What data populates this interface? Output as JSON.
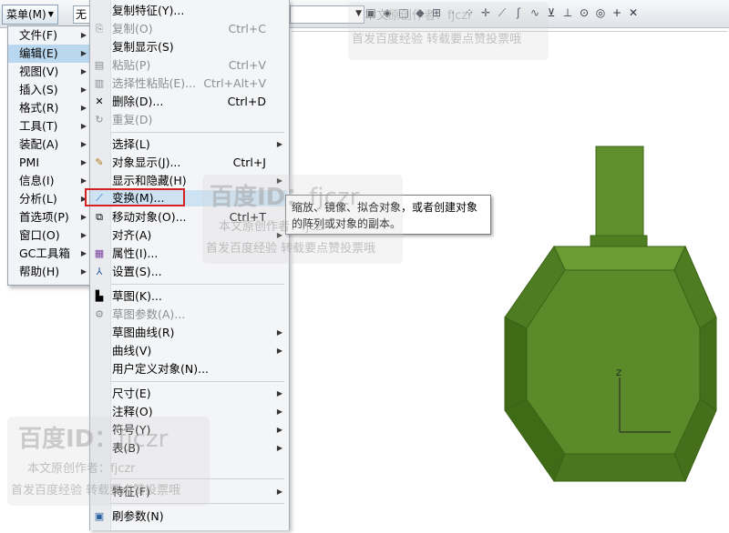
{
  "toolbar": {
    "menu_button": "菜单(M)",
    "filter_value": "无",
    "icons": [
      "view-icon",
      "snap-icon",
      "point-icon",
      "line-icon",
      "curve-icon",
      "arc-icon",
      "circle-icon",
      "plus-icon"
    ]
  },
  "main_menu": {
    "items": [
      {
        "label": "文件(F)",
        "has_sub": true
      },
      {
        "label": "编辑(E)",
        "has_sub": true,
        "active": true
      },
      {
        "label": "视图(V)",
        "has_sub": true
      },
      {
        "label": "插入(S)",
        "has_sub": true
      },
      {
        "label": "格式(R)",
        "has_sub": true
      },
      {
        "label": "工具(T)",
        "has_sub": true
      },
      {
        "label": "装配(A)",
        "has_sub": true
      },
      {
        "label": "PMI",
        "has_sub": true
      },
      {
        "label": "信息(I)",
        "has_sub": true
      },
      {
        "label": "分析(L)",
        "has_sub": true
      },
      {
        "label": "首选项(P)",
        "has_sub": true
      },
      {
        "label": "窗口(O)",
        "has_sub": true
      },
      {
        "label": "GC工具箱",
        "has_sub": true
      },
      {
        "label": "帮助(H)",
        "has_sub": true
      }
    ]
  },
  "edit_menu": {
    "items": [
      {
        "label": "复制特征(Y)...",
        "icon": "",
        "shortcut": ""
      },
      {
        "label": "复制(O)",
        "icon": "copy-icon",
        "shortcut": "Ctrl+C",
        "disabled": true
      },
      {
        "label": "复制显示(S)",
        "icon": "",
        "shortcut": ""
      },
      {
        "label": "粘贴(P)",
        "icon": "paste-icon",
        "shortcut": "Ctrl+V",
        "disabled": true
      },
      {
        "label": "选择性粘贴(E)...",
        "icon": "paste-special-icon",
        "shortcut": "Ctrl+Alt+V",
        "disabled": true
      },
      {
        "label": "删除(D)...",
        "icon": "delete-icon",
        "shortcut": "Ctrl+D"
      },
      {
        "label": "重复(D)",
        "icon": "repeat-icon",
        "shortcut": "",
        "disabled": true
      },
      {
        "label": "选择(L)",
        "icon": "",
        "shortcut": "",
        "sub": true
      },
      {
        "label": "对象显示(J)...",
        "icon": "object-display-icon",
        "shortcut": "Ctrl+J"
      },
      {
        "label": "显示和隐藏(H)",
        "icon": "",
        "shortcut": "",
        "sub": true
      },
      {
        "label": "变换(M)...",
        "icon": "transform-icon",
        "shortcut": "",
        "highlight": true
      },
      {
        "label": "移动对象(O)...",
        "icon": "move-object-icon",
        "shortcut": "Ctrl+T"
      },
      {
        "label": "对齐(A)",
        "icon": "",
        "shortcut": "",
        "sub": true
      },
      {
        "label": "属性(I)...",
        "icon": "properties-icon",
        "shortcut": ""
      },
      {
        "label": "设置(S)...",
        "icon": "settings-icon",
        "shortcut": ""
      },
      {
        "label": "草图(K)...",
        "icon": "sketch-icon",
        "shortcut": ""
      },
      {
        "label": "草图参数(A)...",
        "icon": "sketch-param-icon",
        "shortcut": "",
        "disabled": true
      },
      {
        "label": "草图曲线(R)",
        "icon": "",
        "shortcut": "",
        "sub": true
      },
      {
        "label": "曲线(V)",
        "icon": "",
        "shortcut": "",
        "sub": true
      },
      {
        "label": "用户定义对象(N)...",
        "icon": "",
        "shortcut": ""
      },
      {
        "label": "尺寸(E)",
        "icon": "",
        "shortcut": "",
        "sub": true
      },
      {
        "label": "注释(O)",
        "icon": "",
        "shortcut": "",
        "sub": true
      },
      {
        "label": "符号(Y)",
        "icon": "",
        "shortcut": "",
        "sub": true
      },
      {
        "label": "表(B)",
        "icon": "",
        "shortcut": "",
        "sub": true
      },
      {
        "label": "特征(F)",
        "icon": "",
        "shortcut": "",
        "sub": true
      },
      {
        "label": "刷参数(N)",
        "icon": "refresh-param-icon",
        "shortcut": ""
      }
    ]
  },
  "tooltip": {
    "text": "缩放、镜像、拟合对象，或者创建对象的阵列或对象的副本。"
  },
  "watermark": {
    "brand": "百度ID：",
    "user": "fjczr",
    "author_line": "本文原创作者：fjczr",
    "promo_line": "首发百度经验 转载要点赞投票哦"
  },
  "colors": {
    "model_green": "#5b8a2a",
    "highlight_red": "#d72020",
    "active_item": "#b9d7ee"
  }
}
